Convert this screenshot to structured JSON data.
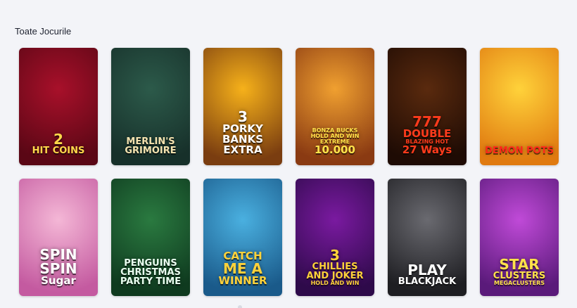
{
  "section": {
    "title": "Toate Jocurile"
  },
  "games": [
    {
      "lines": [
        "2",
        "HIT COINS"
      ],
      "colors": [
        "#a8102a",
        "#5a0715"
      ],
      "text_color": "#ffd84a",
      "icon": "gold-coins-art"
    },
    {
      "lines": [
        "MERLIN'S",
        "GRIMOIRE"
      ],
      "colors": [
        "#2c5a4a",
        "#17302a"
      ],
      "text_color": "#f4e3b0",
      "icon": "spellbook-art"
    },
    {
      "lines": [
        "3",
        "PORKY",
        "BANKS",
        "EXTRA"
      ],
      "colors": [
        "#f6b11a",
        "#7a3d10"
      ],
      "text_color": "#ffffff",
      "icon": "golden-pig-art"
    },
    {
      "lines": [
        "BONZA BUCKS",
        "HOLD AND WIN EXTREME",
        "10.000"
      ],
      "colors": [
        "#f0a030",
        "#8a3a12"
      ],
      "text_color": "#ffe24a",
      "icon": "kangaroo-art"
    },
    {
      "lines": [
        "777",
        "DOUBLE",
        "BLAZING HOT",
        "27 Ways"
      ],
      "colors": [
        "#5a2a0e",
        "#1e0b04"
      ],
      "text_color": "#ff3b1c",
      "icon": "sevens-art"
    },
    {
      "lines": [
        "DEMON POTS"
      ],
      "colors": [
        "#ffd23a",
        "#e07a10"
      ],
      "text_color": "#ff2a1a",
      "icon": "devil-art"
    },
    {
      "lines": [
        "SPIN",
        "SPIN",
        "Sugar"
      ],
      "colors": [
        "#f4b7d6",
        "#c45aa0"
      ],
      "text_color": "#ffffff",
      "icon": "candy-art"
    },
    {
      "lines": [
        "PENGUINS",
        "CHRISTMAS",
        "PARTY TIME"
      ],
      "colors": [
        "#2a7a40",
        "#0f3a1f"
      ],
      "text_color": "#eafff0",
      "icon": "penguins-art"
    },
    {
      "lines": [
        "CATCH",
        "ME A",
        "WINNER"
      ],
      "colors": [
        "#4ab0e0",
        "#1a5a8a"
      ],
      "text_color": "#ffd23a",
      "icon": "fisherman-art"
    },
    {
      "lines": [
        "3",
        "CHILLIES",
        "AND JOKER",
        "HOLD AND WIN"
      ],
      "colors": [
        "#7a1aa0",
        "#2e0a4a"
      ],
      "text_color": "#ffd23a",
      "icon": "jester-art"
    },
    {
      "lines": [
        "PLAY",
        "BLACKJACK"
      ],
      "colors": [
        "#6a6a70",
        "#1e1e22"
      ],
      "text_color": "#ffffff",
      "icon": "dealer-art"
    },
    {
      "lines": [
        "STAR",
        "CLUSTERS",
        "MEGACLUSTERS"
      ],
      "colors": [
        "#c04ad8",
        "#5a1a7a"
      ],
      "text_color": "#ffe24a",
      "icon": "star-art"
    }
  ]
}
